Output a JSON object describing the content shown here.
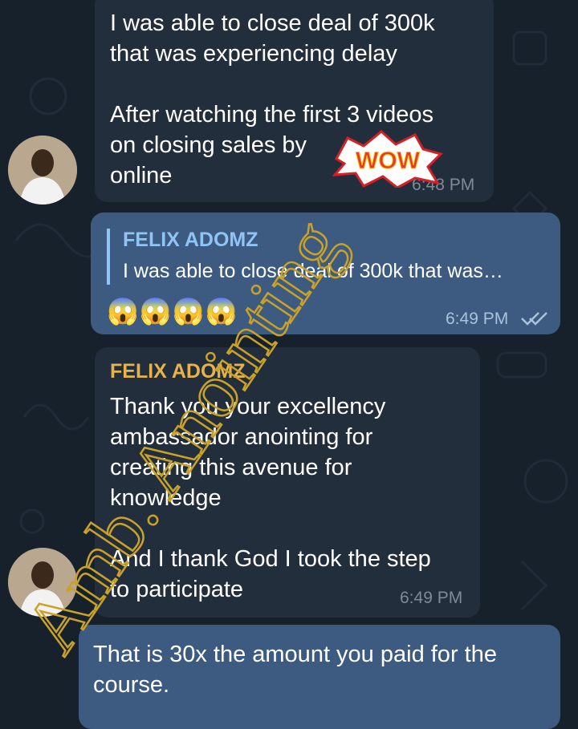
{
  "messages": [
    {
      "type": "incoming",
      "text": "I was able to close deal of 300k\nthat was experiencing delay\n\nAfter watching the first 3 videos\non closing sales by\nonline",
      "time": "6:48 PM",
      "sticker": "WOW"
    },
    {
      "type": "outgoing",
      "reply_to": {
        "sender": "FELIX ADOMZ",
        "text": "I was able to close deal of 300k that was…"
      },
      "text": "😱😱😱😱",
      "time": "6:49 PM",
      "status_icon": "double-check-icon"
    },
    {
      "type": "incoming",
      "sender": "FELIX ADOMZ",
      "text": "Thank you your excellency\nambassador anointing for\ncreating this avenue for\nknowledge\n\nAnd I thank God I took the step\nto participate",
      "time": "6:49 PM"
    },
    {
      "type": "outgoing",
      "text": "That is 30x the amount you paid for the\ncourse."
    }
  ],
  "watermark": "Amb. Anointing",
  "colors": {
    "background": "#17212b",
    "incoming_bubble": "#232e3c",
    "outgoing_bubble": "#3d5a80",
    "sender_name": "#e6b34a",
    "reply_name": "#8fc4f5",
    "watermark": "#c9a227"
  }
}
